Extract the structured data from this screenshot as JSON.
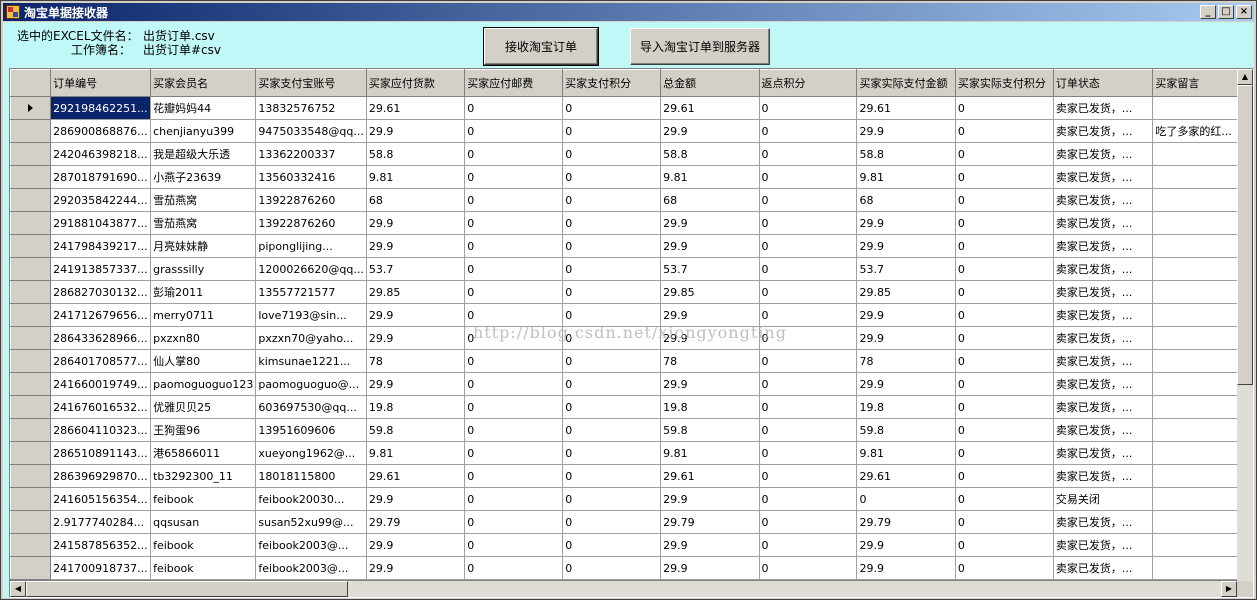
{
  "window": {
    "title": "淘宝单据接收器",
    "controls": {
      "minimize": "_",
      "maximize": "□",
      "close": "×"
    }
  },
  "info": {
    "excel_label": "选中的EXCEL文件名：",
    "excel_value": "出货订单.csv",
    "sheet_label": "工作簿名：",
    "sheet_value": "出货订单#csv"
  },
  "buttons": {
    "receive": "接收淘宝订单",
    "import": "导入淘宝订单到服务器"
  },
  "grid": {
    "columns": [
      "订单编号",
      "买家会员名",
      "买家支付宝账号",
      "买家应付货款",
      "买家应付邮费",
      "买家支付积分",
      "总金额",
      "返点积分",
      "买家实际支付金额",
      "买家实际支付积分",
      "订单状态",
      "买家留言"
    ],
    "rows": [
      [
        "292198462251...",
        "花瓣妈妈44",
        "13832576752",
        "29.61",
        "0",
        "0",
        "29.61",
        "0",
        "29.61",
        "0",
        "卖家已发货，...",
        ""
      ],
      [
        "286900868876...",
        "chenjianyu399",
        "9475033548@qq...",
        "29.9",
        "0",
        "0",
        "29.9",
        "0",
        "29.9",
        "0",
        "卖家已发货，...",
        "吃了多家的红..."
      ],
      [
        "242046398218...",
        "我是超级大乐透",
        "13362200337",
        "58.8",
        "0",
        "0",
        "58.8",
        "0",
        "58.8",
        "0",
        "卖家已发货，...",
        ""
      ],
      [
        "287018791690...",
        "小燕子23639",
        "13560332416",
        "9.81",
        "0",
        "0",
        "9.81",
        "0",
        "9.81",
        "0",
        "卖家已发货，...",
        ""
      ],
      [
        "292035842244...",
        "雪茄燕窝",
        "13922876260",
        "68",
        "0",
        "0",
        "68",
        "0",
        "68",
        "0",
        "卖家已发货，...",
        ""
      ],
      [
        "291881043877...",
        "雪茄燕窝",
        "13922876260",
        "29.9",
        "0",
        "0",
        "29.9",
        "0",
        "29.9",
        "0",
        "卖家已发货，...",
        ""
      ],
      [
        "241798439217...",
        "月亮妹妹静",
        "piponglijing...",
        "29.9",
        "0",
        "0",
        "29.9",
        "0",
        "29.9",
        "0",
        "卖家已发货，...",
        ""
      ],
      [
        "241913857337...",
        "grasssilly",
        "1200026620@qq...",
        "53.7",
        "0",
        "0",
        "53.7",
        "0",
        "53.7",
        "0",
        "卖家已发货，...",
        ""
      ],
      [
        "286827030132...",
        "彭瑜2011",
        "13557721577",
        "29.85",
        "0",
        "0",
        "29.85",
        "0",
        "29.85",
        "0",
        "卖家已发货，...",
        ""
      ],
      [
        "241712679656...",
        "merry0711",
        "love7193@sin...",
        "29.9",
        "0",
        "0",
        "29.9",
        "0",
        "29.9",
        "0",
        "卖家已发货，...",
        ""
      ],
      [
        "286433628966...",
        "pxzxn80",
        "pxzxn70@yaho...",
        "29.9",
        "0",
        "0",
        "29.9",
        "0",
        "29.9",
        "0",
        "卖家已发货，...",
        ""
      ],
      [
        "286401708577...",
        "仙人掌80",
        "kimsunae1221...",
        "78",
        "0",
        "0",
        "78",
        "0",
        "78",
        "0",
        "卖家已发货，...",
        ""
      ],
      [
        "241660019749...",
        "paomoguoguo123",
        "paomoguoguo@...",
        "29.9",
        "0",
        "0",
        "29.9",
        "0",
        "29.9",
        "0",
        "卖家已发货，...",
        ""
      ],
      [
        "241676016532...",
        "优雅贝贝25",
        "603697530@qq...",
        "19.8",
        "0",
        "0",
        "19.8",
        "0",
        "19.8",
        "0",
        "卖家已发货，...",
        ""
      ],
      [
        "286604110323...",
        "王狗蛋96",
        "13951609606",
        "59.8",
        "0",
        "0",
        "59.8",
        "0",
        "59.8",
        "0",
        "卖家已发货，...",
        ""
      ],
      [
        "286510891143...",
        "港65866011",
        "xueyong1962@...",
        "9.81",
        "0",
        "0",
        "9.81",
        "0",
        "9.81",
        "0",
        "卖家已发货，...",
        ""
      ],
      [
        "286396929870...",
        "tb3292300_11",
        "18018115800",
        "29.61",
        "0",
        "0",
        "29.61",
        "0",
        "29.61",
        "0",
        "卖家已发货，...",
        ""
      ],
      [
        "241605156354...",
        "feibook",
        "feibook20030...",
        "29.9",
        "0",
        "0",
        "29.9",
        "0",
        "0",
        "0",
        "交易关闭",
        ""
      ],
      [
        "2.9177740284...",
        "qqsusan",
        "susan52xu99@...",
        "29.79",
        "0",
        "0",
        "29.79",
        "0",
        "29.79",
        "0",
        "卖家已发货，...",
        ""
      ],
      [
        "241587856352...",
        "feibook",
        "feibook2003@...",
        "29.9",
        "0",
        "0",
        "29.9",
        "0",
        "29.9",
        "0",
        "卖家已发货，...",
        ""
      ],
      [
        "241700918737...",
        "feibook",
        "feibook2003@...",
        "29.9",
        "0",
        "0",
        "29.9",
        "0",
        "29.9",
        "0",
        "卖家已发货，...",
        ""
      ]
    ]
  },
  "watermark": "http://blog.csdn.net/xiongyongting",
  "scroll_icons": {
    "up": "▲",
    "down": "▼",
    "left": "◀",
    "right": "▶"
  }
}
